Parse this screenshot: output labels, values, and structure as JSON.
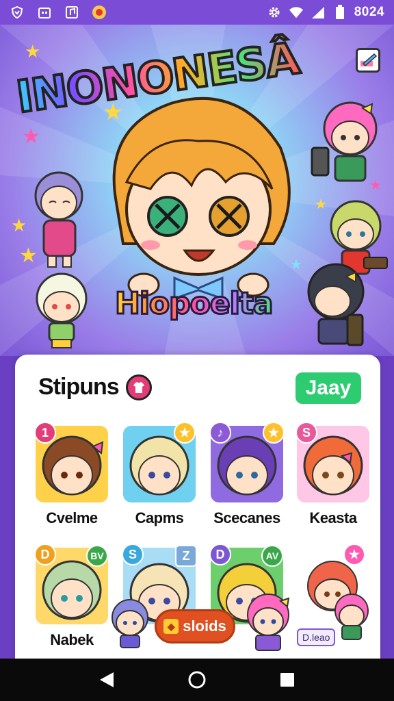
{
  "status_bar": {
    "time": "8024",
    "icons": [
      "shield-icon",
      "calendar-icon",
      "music-icon",
      "record-icon",
      "gear-icon",
      "wifi-icon",
      "signal-icon",
      "battery-icon"
    ]
  },
  "hero": {
    "logo_text": "INONONESÂ",
    "subtitle": "Hiopoelta"
  },
  "panel": {
    "title": "Stipuns",
    "join_label": "Jaay",
    "cards": [
      {
        "label": "Cvelme",
        "badge": "1",
        "badge_color": "#e33d79",
        "bg": "#ffd04a",
        "hair": "#8a4a26"
      },
      {
        "label": "Capms",
        "badge": "★",
        "badge_color": "#ffc12b",
        "bg": "#6fd0ef",
        "hair": "#f2e4a8"
      },
      {
        "label": "Scecanes",
        "badge": "♪",
        "badge_color": "#8c5ad6",
        "bg": "#8f6ae0",
        "hair": "#6a3fb5"
      },
      {
        "label": "Keasta",
        "badge": "S",
        "badge_color": "#e8589a",
        "bg": "#ffc7e6",
        "hair": "#f06a3a"
      },
      {
        "label": "Nabek",
        "badge": "D",
        "badge_color": "#f0a020",
        "bg": "#ffd86a",
        "hair": "#b7d8a7"
      },
      {
        "label": "",
        "badge": "S",
        "badge_color": "#3aa8e0",
        "bg": "#a9dcf5",
        "hair": "#f6e3b6"
      },
      {
        "label": "",
        "badge": "D",
        "badge_color": "#7b57d6",
        "bg": "#6dcf6b",
        "hair": "#f3cf3a"
      }
    ],
    "card_corner_tags": [
      "",
      "",
      "",
      "",
      "BV",
      "Z",
      "AV"
    ],
    "sleds_label": "sloids",
    "tag_label": "D.leao"
  },
  "nav_bar": {
    "icons": [
      "back-icon",
      "home-icon",
      "recents-icon"
    ]
  },
  "colors": {
    "status_bar": "#7b4dd6",
    "join": "#2ecc71",
    "sleds": "#e05020"
  }
}
